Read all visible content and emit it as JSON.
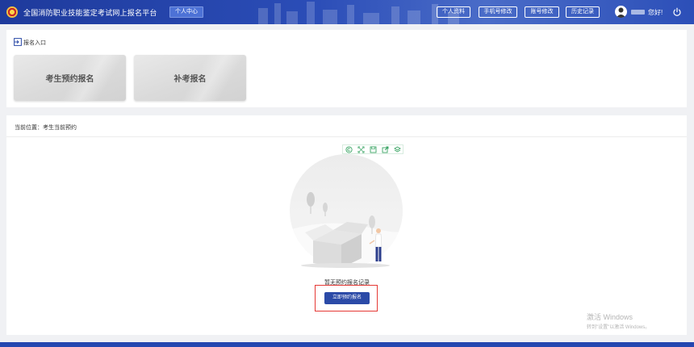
{
  "header": {
    "site_title": "全国消防职业技能鉴定考试网上报名平台",
    "personal_center": "个人中心",
    "buttons": [
      {
        "label": "个人资料"
      },
      {
        "label": "手机号修改"
      },
      {
        "label": "账号修改"
      },
      {
        "label": "历史记录"
      }
    ],
    "greeting": "您好!"
  },
  "entry_section": {
    "label": "报名入口",
    "cards": [
      {
        "label": "考生预约报名"
      },
      {
        "label": "补考报名"
      }
    ]
  },
  "main": {
    "breadcrumb": "当前位置：考生当前预约",
    "toolbar_icons": [
      "copyright-icon",
      "expand-icon",
      "save-icon",
      "share-icon",
      "layers-icon"
    ],
    "empty_text": "暂无预约报名记录",
    "reserve_button": "立即预约报名"
  },
  "watermark": {
    "line1": "激活 Windows",
    "line2": "转到\"设置\"以激活 Windows。"
  },
  "colors": {
    "header": "#2b4db7",
    "primary_button": "#2b4aa7",
    "highlight": "#e53935",
    "toolbar_icon": "#3aa564"
  }
}
